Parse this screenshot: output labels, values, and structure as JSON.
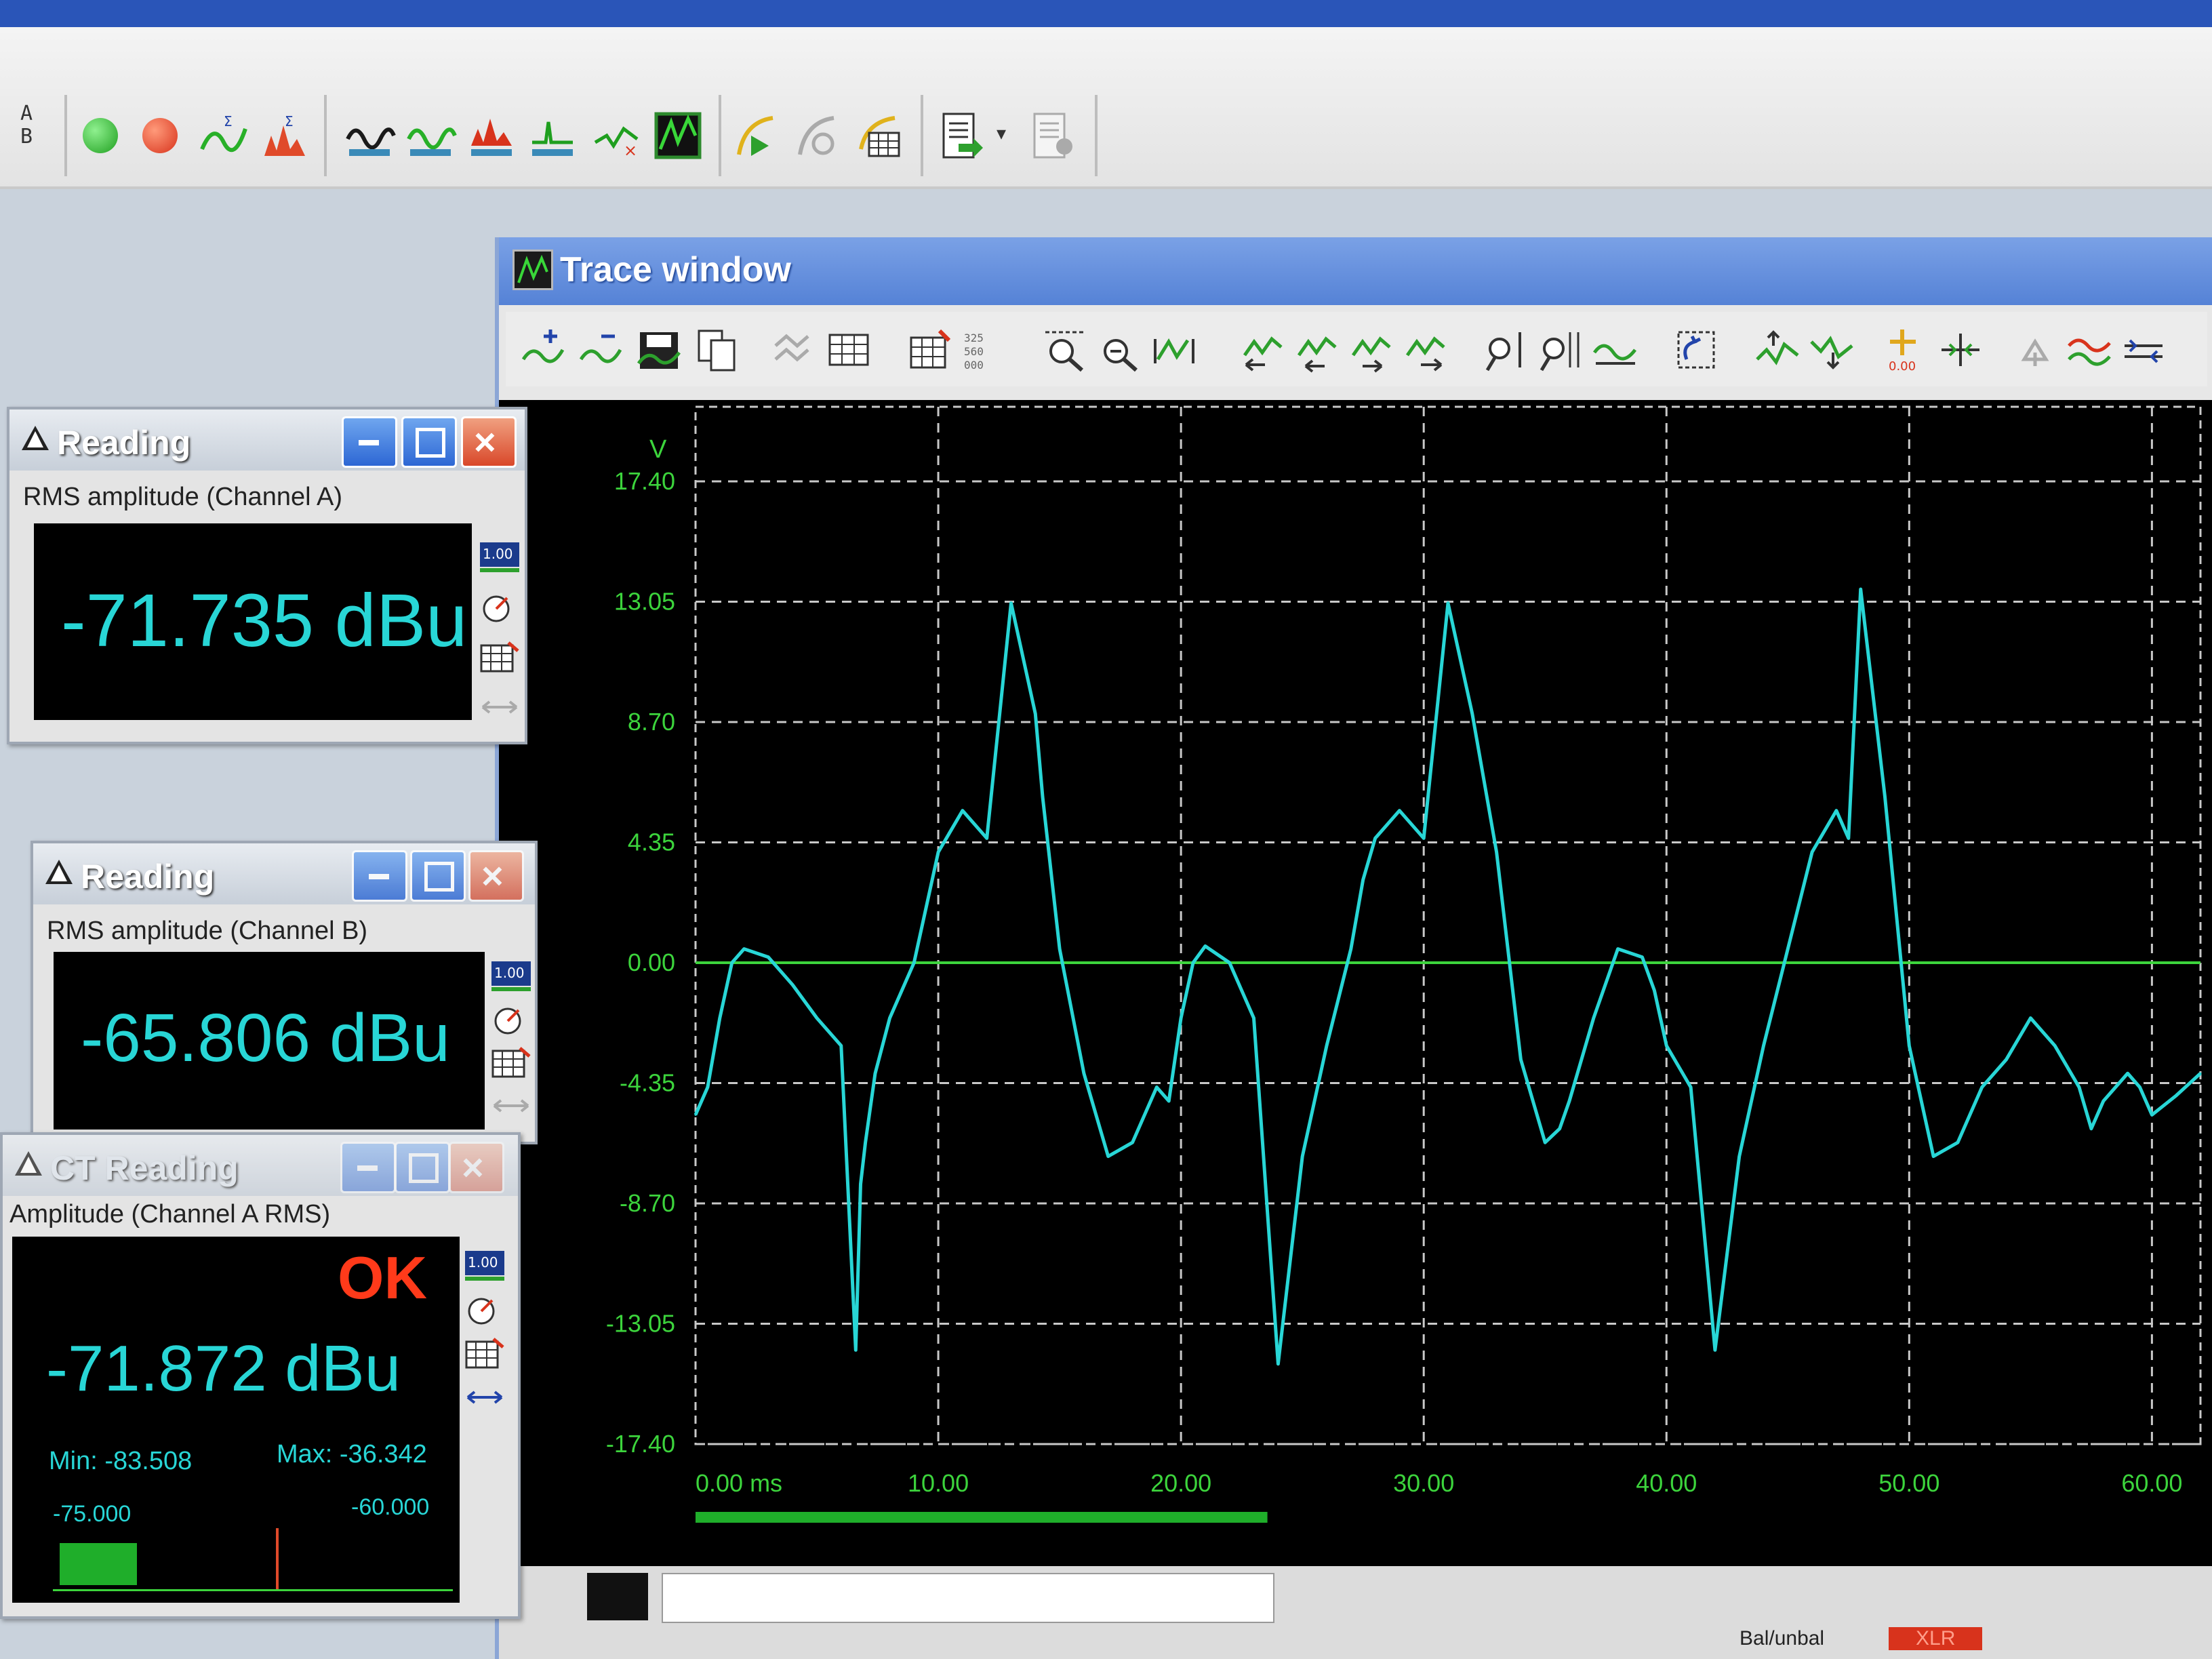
{
  "app_toolbar": {
    "ab_label_a": "A",
    "ab_label_b": "B",
    "icons": [
      "ab-switch-icon",
      "start-icon",
      "stop-icon",
      "sweep-icon",
      "sweep-fft-icon",
      "waveform-icon",
      "waveform-multi-icon",
      "spectrum-icon",
      "histogram-icon",
      "trace-x-icon",
      "trace-window-icon",
      "play-curve-icon",
      "curve-icon",
      "settings-grid-icon",
      "report-icon",
      "dropdown-icon",
      "report-export-icon"
    ]
  },
  "trace_window": {
    "title": "Trace window",
    "y_unit": "V",
    "x_unit_label": "0.00 ms",
    "toolbar_icons": [
      "add-trace-icon",
      "remove-trace-icon",
      "save-trace-icon",
      "copy-icon",
      "compare-icon",
      "table-icon",
      "edit-table-icon",
      "number-format-icon",
      "zoom-in-icon",
      "zoom-out-icon",
      "fit-icon",
      "prev-icon",
      "cursor-icon",
      "cursor2-icon",
      "next-icon",
      "zoom-y-icon",
      "zoom-x-icon",
      "auto-scale-icon",
      "refresh-icon",
      "peak-up-icon",
      "peak-down-icon",
      "offset-icon",
      "move-icon",
      "undo-icon",
      "overlay-icon",
      "settings-icon"
    ],
    "status_bar": {
      "balanced_label": "Bal/unbal",
      "xlr_label": "XLR"
    },
    "colors": {
      "trace": "#28d6d6",
      "zero_line": "#3cd43c",
      "grid": "#c8c8c8",
      "axis_text": "#3cd43c"
    }
  },
  "chart_data": {
    "type": "line",
    "title": "",
    "xlabel": "",
    "ylabel": "V",
    "xlim": [
      0,
      62
    ],
    "ylim": [
      -17.4,
      17.4
    ],
    "x_ticks": [
      "0.00 ms",
      "10.00",
      "20.00",
      "30.00",
      "40.00",
      "50.00",
      "60.00"
    ],
    "y_ticks": [
      "17.40",
      "13.05",
      "8.70",
      "4.35",
      "0.00",
      "-4.35",
      "-8.70",
      "-13.05",
      "-17.40"
    ],
    "grid": true,
    "series": [
      {
        "x": [
          0.0,
          0.5,
          1.0,
          1.5,
          2.0,
          3.0,
          4.0,
          5.0,
          6.0,
          6.6,
          6.8,
          7.0,
          7.4,
          8.0,
          9.0,
          10.0,
          11.0,
          12.0,
          13.0,
          14.0,
          14.3,
          15.0,
          16.0,
          17.0,
          18.0,
          19.0,
          19.5,
          20.0,
          20.5,
          21.0,
          22.0,
          23.0,
          24.0,
          25.0,
          26.0,
          27.0,
          27.5,
          28.0,
          29.0,
          30.0,
          31.0,
          32.0,
          33.0,
          34.0,
          35.0,
          35.6,
          36.0,
          37.0,
          38.0,
          39.0,
          39.5,
          40.0,
          41.0,
          42.0,
          43.0,
          44.0,
          45.0,
          46.0,
          47.0,
          47.5,
          48.0,
          49.0,
          50.0,
          51.0,
          52.0,
          53.0,
          54.0,
          55.0,
          56.0,
          57.0,
          57.5,
          58.0,
          59.0,
          59.5,
          60.0,
          61.0,
          62.0
        ],
        "y": [
          -5.5,
          -4.5,
          -2.0,
          0.0,
          0.5,
          0.2,
          -0.8,
          -2.0,
          -3.0,
          -14.0,
          -8.0,
          -6.5,
          -4.0,
          -2.0,
          0.0,
          4.0,
          5.5,
          4.5,
          13.0,
          9.0,
          6.0,
          0.5,
          -4.0,
          -7.0,
          -6.5,
          -4.5,
          -5.0,
          -2.0,
          0.0,
          0.6,
          0.0,
          -2.0,
          -14.5,
          -7.0,
          -3.0,
          0.5,
          3.0,
          4.5,
          5.5,
          4.5,
          13.0,
          9.0,
          4.0,
          -3.5,
          -6.5,
          -6.0,
          -5.0,
          -2.0,
          0.5,
          0.2,
          -1.0,
          -3.0,
          -4.5,
          -14.0,
          -7.0,
          -3.0,
          0.5,
          4.0,
          5.5,
          4.5,
          13.5,
          6.0,
          -3.0,
          -7.0,
          -6.5,
          -4.5,
          -3.5,
          -2.0,
          -3.0,
          -4.5,
          -6.0,
          -5.0,
          -4.0,
          -4.5,
          -5.5,
          -4.8,
          -4.0
        ]
      }
    ]
  },
  "panels": [
    {
      "title": "Reading",
      "subtitle": "RMS amplitude (Channel A)",
      "value": "-71.735 dBu",
      "side_icons": [
        "scale-100-icon",
        "gauge-icon",
        "table-icon",
        "arrows-icon"
      ],
      "side_badge": "1.00"
    },
    {
      "title": "Reading",
      "subtitle": "RMS amplitude (Channel B)",
      "value": "-65.806 dBu",
      "side_icons": [
        "scale-100-icon",
        "gauge-icon",
        "table-icon",
        "arrows-icon"
      ],
      "side_badge": "1.00"
    },
    {
      "title": "CT Reading",
      "subtitle": "Amplitude (Channel A RMS)",
      "value": "-71.872 dBu",
      "status": "OK",
      "min_label": "Min: -83.508",
      "max_label": "Max: -36.342",
      "scale_min": "-75.000",
      "scale_max": "-60.000",
      "side_icons": [
        "scale-100-icon",
        "gauge-icon",
        "table-icon",
        "arrows-icon"
      ],
      "side_badge": "1.00",
      "level_fraction": 0.7
    }
  ]
}
